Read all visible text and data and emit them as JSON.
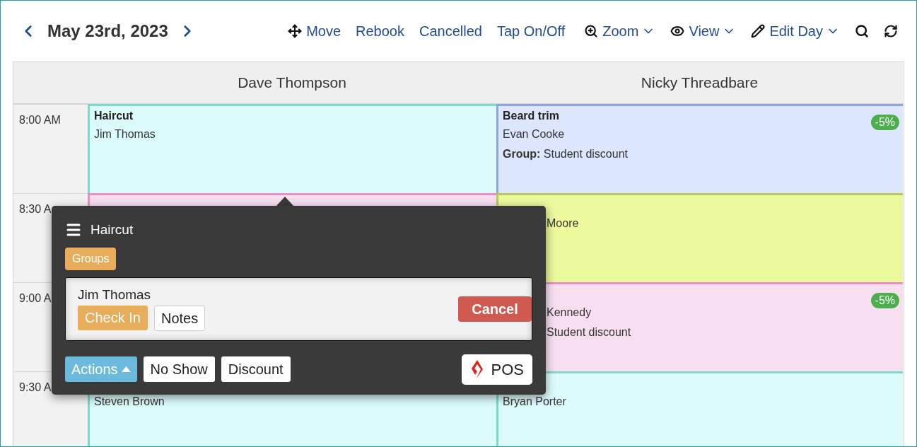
{
  "toolbar": {
    "date": "May 23rd, 2023",
    "actions": [
      {
        "label": "Move",
        "dropdown": false
      },
      {
        "label": "Rebook",
        "dropdown": false
      },
      {
        "label": "Cancelled",
        "dropdown": false
      },
      {
        "label": "Tap On/Off",
        "dropdown": false
      },
      {
        "label": "Zoom",
        "dropdown": true
      },
      {
        "label": "View",
        "dropdown": true
      },
      {
        "label": "Edit Day",
        "dropdown": true
      }
    ]
  },
  "columns": [
    "Dave Thompson",
    "Nicky Threadbare"
  ],
  "rows": [
    {
      "time": "8:00 AM",
      "cells": [
        {
          "kind": "appointment",
          "title": "Haircut",
          "client": "Jim Thomas",
          "color": "#7fd8cc",
          "obscured": false
        },
        {
          "kind": "appointment",
          "title": "Beard trim",
          "client": "Evan Cooke",
          "group_label": "Group:",
          "group": "Student discount",
          "badge": "-5%",
          "color": "#8aa6dc",
          "obscured": false
        }
      ]
    },
    {
      "time": "8:30 A",
      "cells": [
        {
          "kind": "appointment",
          "color": "#e88fc8"
        },
        {
          "kind": "appointment",
          "client": "Moore",
          "color": "#b8c85a",
          "obscured": true
        }
      ]
    },
    {
      "time": "9:00 A",
      "cells": [
        {
          "kind": "empty"
        },
        {
          "kind": "appointment",
          "client": "Kennedy",
          "group": "Student discount",
          "badge": "-5%",
          "color": "#e88fc8",
          "obscured": true
        }
      ]
    },
    {
      "time": "9:30 A",
      "cells": [
        {
          "kind": "appointment",
          "client": "Steven Brown",
          "color": "#7fd8cc",
          "obscured": false
        },
        {
          "kind": "appointment",
          "client": "Bryan Porter",
          "color": "#7fd8cc",
          "obscured": false
        }
      ]
    }
  ],
  "popup": {
    "title": "Haircut",
    "groups": "Groups",
    "client": "Jim Thomas",
    "check_in": "Check In",
    "notes": "Notes",
    "cancel": "Cancel",
    "actions": "Actions",
    "buttons": [
      "No Show",
      "Discount"
    ],
    "pos": "POS"
  }
}
